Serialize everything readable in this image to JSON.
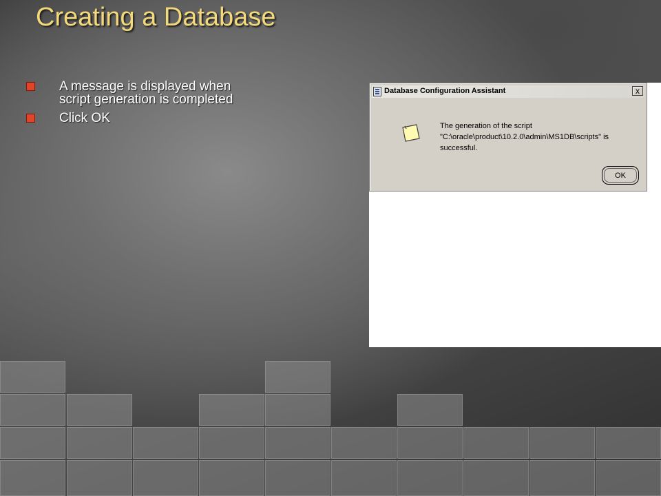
{
  "slide": {
    "title": "Creating a Database",
    "bullets": [
      "A message is displayed when script generation is completed",
      "Click OK"
    ]
  },
  "dialog": {
    "title": "Database Configuration Assistant",
    "close_label": "x",
    "message": "The generation of the script \"C:\\oracle\\product\\10.2.0\\admin\\MS1DB\\scripts\" is successful.",
    "ok_label": "OK",
    "icons": {
      "title": "app-icon",
      "message": "note-icon",
      "close": "close-icon"
    }
  },
  "colors": {
    "title": "#f3d97a",
    "bullet": "#e0452a",
    "dialog_bg": "#d4d0c8"
  }
}
